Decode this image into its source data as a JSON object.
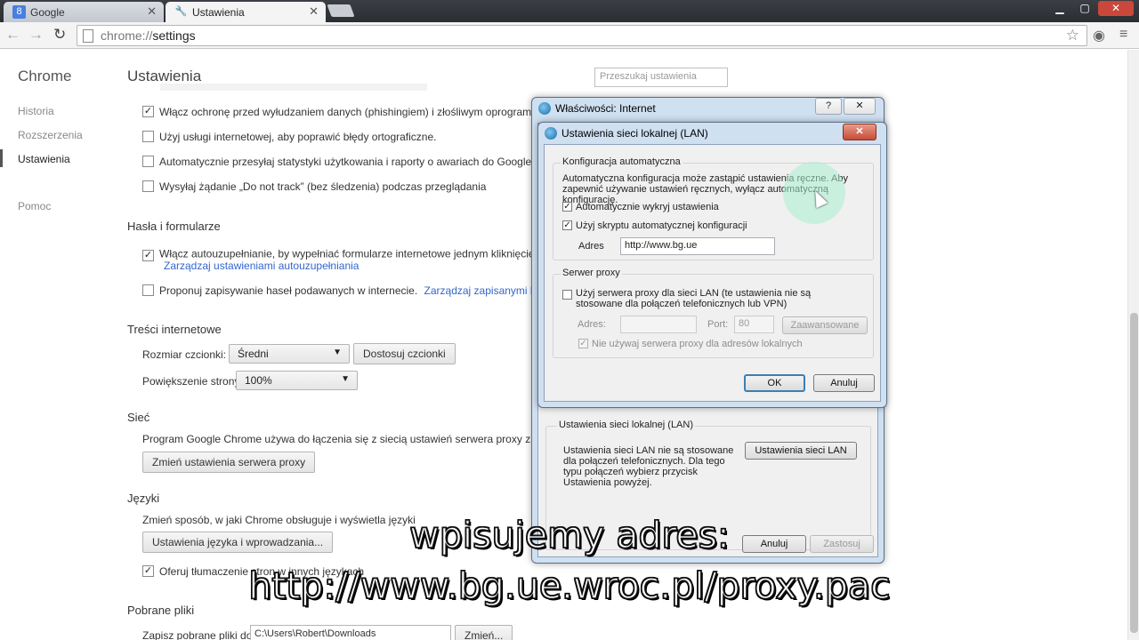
{
  "browser": {
    "tabs": [
      {
        "label": "Google",
        "active": false,
        "icon": "google-icon"
      },
      {
        "label": "Ustawienia",
        "active": true,
        "icon": "wrench-icon"
      }
    ],
    "url_scheme": "chrome://",
    "url_rest": "settings"
  },
  "sidebar": {
    "title": "Chrome",
    "items": [
      {
        "label": "Historia"
      },
      {
        "label": "Rozszerzenia"
      },
      {
        "label": "Ustawienia"
      },
      {
        "label": "Pomoc"
      }
    ]
  },
  "settings": {
    "title": "Ustawienia",
    "search_placeholder": "Przeszukaj ustawienia",
    "privacy": [
      {
        "label": "Włącz ochronę przed wyłudzaniem danych (phishingiem) i złośliwym oprogramowaniem",
        "checked": true
      },
      {
        "label": "Użyj usługi internetowej, aby poprawić błędy ortograficzne.",
        "checked": false
      },
      {
        "label": "Automatycznie przesyłaj statystyki użytkowania i raporty o awariach do Google",
        "checked": false
      },
      {
        "label": "Wysyłaj żądanie „Do not track” (bez śledzenia) podczas przeglądania",
        "checked": false
      }
    ],
    "passwords": {
      "heading": "Hasła i formularze",
      "autofill_label": "Włącz autouzupełnianie, by wypełniać formularze internetowe jednym kliknięciem.",
      "autofill_link": "Zarządzaj ustawieniami autouzupełniania",
      "save_pw_label": "Proponuj zapisywanie haseł podawanych w internecie.",
      "save_pw_link": "Zarządzaj zapisanymi hasłami"
    },
    "web_content": {
      "heading": "Treści internetowe",
      "font_size_label": "Rozmiar czcionki:",
      "font_size_value": "Średni",
      "customize_fonts": "Dostosuj czcionki",
      "zoom_label": "Powiększenie strony:",
      "zoom_value": "100%"
    },
    "network": {
      "heading": "Sieć",
      "desc": "Program Google Chrome używa do łączenia się z siecią ustawień serwera proxy z systemu",
      "button": "Zmień ustawienia serwera proxy"
    },
    "languages": {
      "heading": "Języki",
      "desc": "Zmień sposób, w jaki Chrome obsługuje i wyświetla języki",
      "button": "Ustawienia języka i wprowadzania...",
      "translate_label": "Oferuj tłumaczenie stron w innych językach",
      "translate_checked": true
    },
    "downloads": {
      "heading": "Pobrane pliki",
      "save_to_label": "Zapisz pobrane pliki do:",
      "path": "C:\\Users\\Robert\\Downloads",
      "change_button": "Zmień..."
    }
  },
  "internet_properties": {
    "title": "Właściwości: Internet",
    "help": "?",
    "close": "✕",
    "lan_group_label": "Ustawienia sieci lokalnej (LAN)",
    "lan_desc": "Ustawienia sieci LAN nie są stosowane dla połączeń telefonicznych. Dla tego typu połączeń wybierz przycisk Ustawienia powyżej.",
    "lan_button": "Ustawienia sieci LAN",
    "cancel": "Anuluj",
    "apply": "Zastosuj"
  },
  "lan_dialog": {
    "title": "Ustawienia sieci lokalnej (LAN)",
    "close": "✕",
    "auto_group": "Konfiguracja automatyczna",
    "auto_desc": "Automatyczna konfiguracja może zastąpić ustawienia ręczne. Aby zapewnić używanie ustawień ręcznych, wyłącz automatyczną konfigurację.",
    "auto_detect_label": "Automatycznie wykryj ustawienia",
    "auto_detect_checked": true,
    "use_script_label": "Użyj skryptu automatycznej konfiguracji",
    "use_script_checked": true,
    "address_label": "Adres",
    "address_value": "http://www.bg.ue",
    "proxy_group": "Serwer proxy",
    "use_proxy_label": "Użyj serwera proxy dla sieci LAN (te ustawienia nie są stosowane dla połączeń telefonicznych lub VPN)",
    "use_proxy_checked": false,
    "proxy_address_label": "Adres:",
    "port_label": "Port:",
    "port_value": "80",
    "advanced_button": "Zaawansowane",
    "bypass_label": "Nie używaj serwera proxy dla adresów lokalnych",
    "bypass_checked": true,
    "ok": "OK",
    "cancel": "Anuluj"
  },
  "caption": {
    "line1": "wpisujemy adres:",
    "line2": "http://www.bg.ue.wroc.pl/proxy.pac"
  }
}
